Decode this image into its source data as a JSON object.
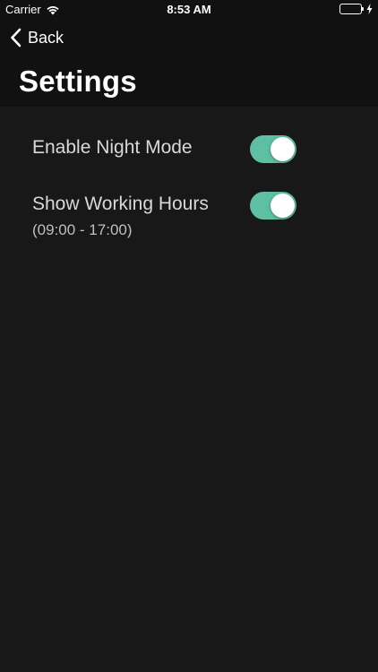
{
  "status_bar": {
    "carrier": "Carrier",
    "time": "8:53 AM",
    "battery_color": "#4cd964"
  },
  "nav": {
    "back_label": "Back",
    "title": "Settings"
  },
  "settings": [
    {
      "label": "Enable Night Mode",
      "sublabel": "",
      "enabled": true
    },
    {
      "label": "Show Working Hours",
      "sublabel": "(09:00 - 17:00)",
      "enabled": true
    }
  ],
  "colors": {
    "background": "#181818",
    "header": "#111111",
    "toggle_on": "#5fbfa3"
  }
}
